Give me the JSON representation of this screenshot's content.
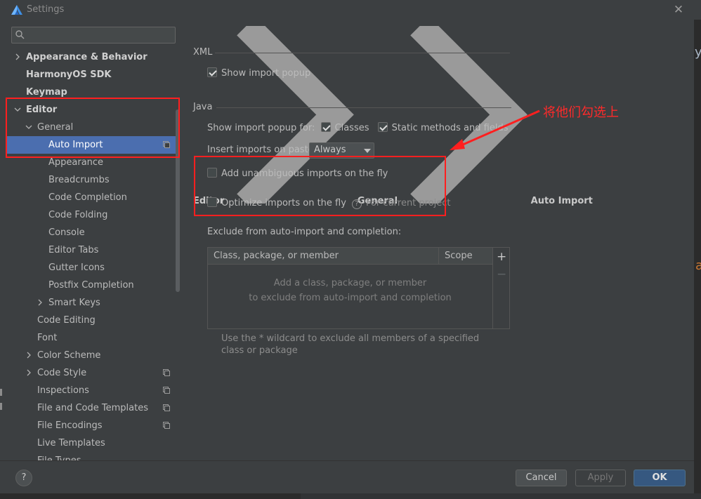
{
  "window": {
    "title": "Settings",
    "close_glyph": "✕"
  },
  "search": {
    "placeholder": "",
    "value": ""
  },
  "sidebar": {
    "items": [
      {
        "label": "Appearance & Behavior",
        "bold": true,
        "expandable": true,
        "expanded": false
      },
      {
        "label": "HarmonyOS SDK",
        "bold": true
      },
      {
        "label": "Keymap",
        "bold": true
      },
      {
        "label": "Editor",
        "bold": true,
        "expandable": true,
        "expanded": true
      },
      {
        "label": "General",
        "expandable": true,
        "expanded": true
      },
      {
        "label": "Auto Import",
        "selected": true,
        "project_icon": true
      },
      {
        "label": "Appearance"
      },
      {
        "label": "Breadcrumbs"
      },
      {
        "label": "Code Completion"
      },
      {
        "label": "Code Folding"
      },
      {
        "label": "Console"
      },
      {
        "label": "Editor Tabs"
      },
      {
        "label": "Gutter Icons"
      },
      {
        "label": "Postfix Completion"
      },
      {
        "label": "Smart Keys",
        "expandable": true,
        "expanded": false
      },
      {
        "label": "Code Editing"
      },
      {
        "label": "Font"
      },
      {
        "label": "Color Scheme",
        "expandable": true,
        "expanded": false
      },
      {
        "label": "Code Style",
        "expandable": true,
        "expanded": false,
        "project_icon": true
      },
      {
        "label": "Inspections",
        "project_icon": true
      },
      {
        "label": "File and Code Templates",
        "project_icon": true
      },
      {
        "label": "File Encodings",
        "project_icon": true
      },
      {
        "label": "Live Templates"
      },
      {
        "label": "File Types"
      }
    ]
  },
  "breadcrumb": {
    "items": [
      "Editor",
      "General",
      "Auto Import"
    ]
  },
  "xml": {
    "section_title": "XML",
    "show_import_popup": {
      "label": "Show import popup",
      "checked": true
    }
  },
  "java": {
    "section_title": "Java",
    "show_popup_for_label": "Show import popup for:",
    "classes": {
      "label": "Classes",
      "checked": true
    },
    "static_methods": {
      "label": "Static methods and fields",
      "checked": true
    },
    "insert_on_paste_label": "Insert imports on paste:",
    "insert_on_paste_value": "Always",
    "add_unambiguous": {
      "label": "Add unambiguous imports on the fly",
      "checked": false
    },
    "optimize_imports": {
      "label": "Optimize imports on the fly",
      "checked": false,
      "hint": "For current project"
    },
    "exclude_label": "Exclude from auto-import and completion:",
    "table": {
      "columns": [
        "Class, package, or member",
        "Scope"
      ],
      "empty_line1": "Add a class, package, or member",
      "empty_line2": "to exclude from auto-import and completion"
    },
    "note": "Use the * wildcard to exclude all members of a specified class or package"
  },
  "footer": {
    "help": "?",
    "cancel": "Cancel",
    "apply": "Apply",
    "ok": "OK"
  },
  "annotation": {
    "text": "将他们勾选上",
    "color": "#ff1f1f"
  },
  "background_fragments": {
    "top": "y",
    "middle": "a"
  },
  "colors": {
    "selection": "#4b6eaf",
    "ok_button": "#365880",
    "dialog_bg": "#3c3f41"
  }
}
